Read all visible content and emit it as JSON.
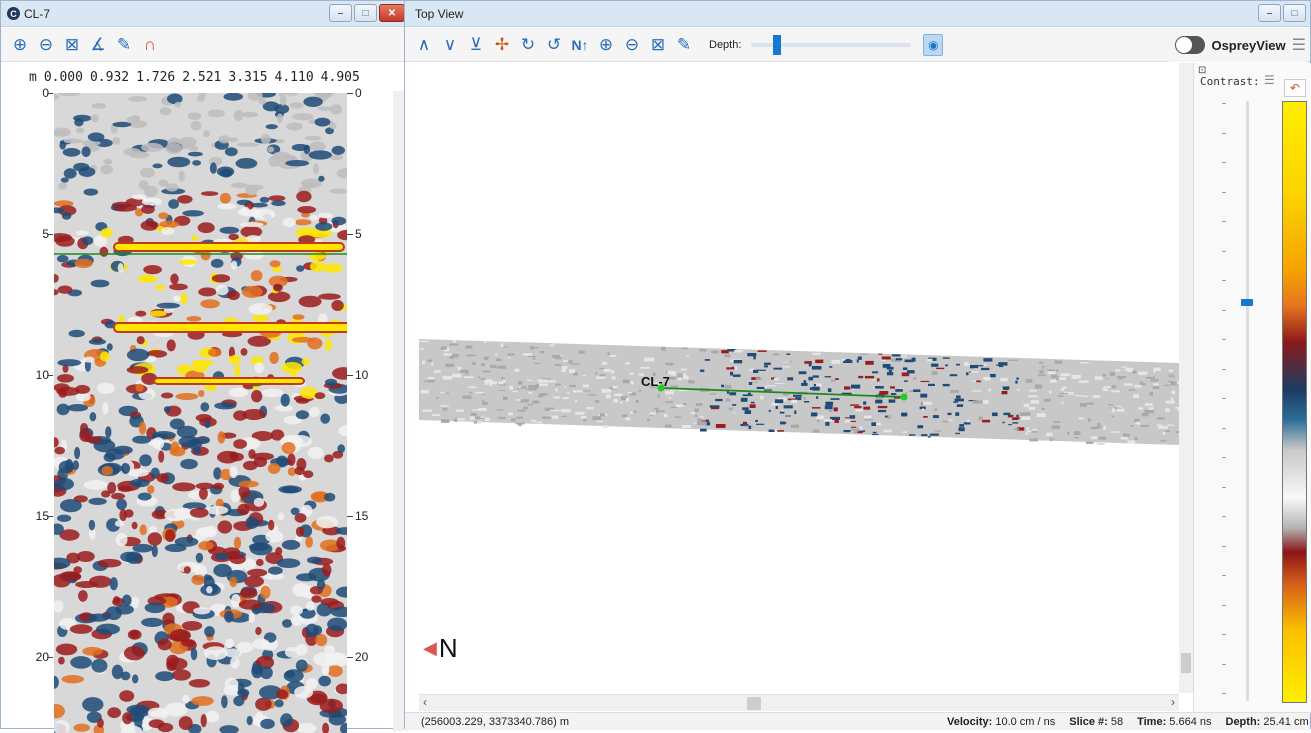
{
  "left_window": {
    "title": "CL-7",
    "app_icon_letter": "C",
    "scale_unit": "m",
    "scale_ticks": [
      "0.000",
      "0.932",
      "1.726",
      "2.521",
      "3.315",
      "4.110",
      "4.905"
    ],
    "depth_ticks": [
      "0",
      "5",
      "10",
      "15",
      "20"
    ],
    "tools": [
      "zoom-in-icon",
      "zoom-out-icon",
      "fit-extent-icon",
      "wiggle-icon",
      "measure-icon",
      "hyperbola-icon"
    ]
  },
  "right_window": {
    "title": "Top View",
    "depth_label": "Depth:",
    "depth_slider_fraction": 0.16,
    "osprey_label": "OspreyView",
    "line_label": "CL-7",
    "north_label": "N",
    "contrast_label": "Contrast:",
    "contrast_fraction": 0.33
  },
  "status": {
    "coords": "(256003.229, 3373340.786) m",
    "velocity_label": "Velocity:",
    "velocity_value": "10.0 cm / ns",
    "slice_label": "Slice #:",
    "slice_value": "58",
    "time_label": "Time:",
    "time_value": "5.664 ns",
    "depth_label": "Depth:",
    "depth_value": "25.41 cm"
  },
  "colors": {
    "accent": "#1578d1",
    "green_line": "#1a8a1a",
    "hot": "#ffe600",
    "red": "#9b1c1c",
    "blue": "#1e4b78"
  }
}
